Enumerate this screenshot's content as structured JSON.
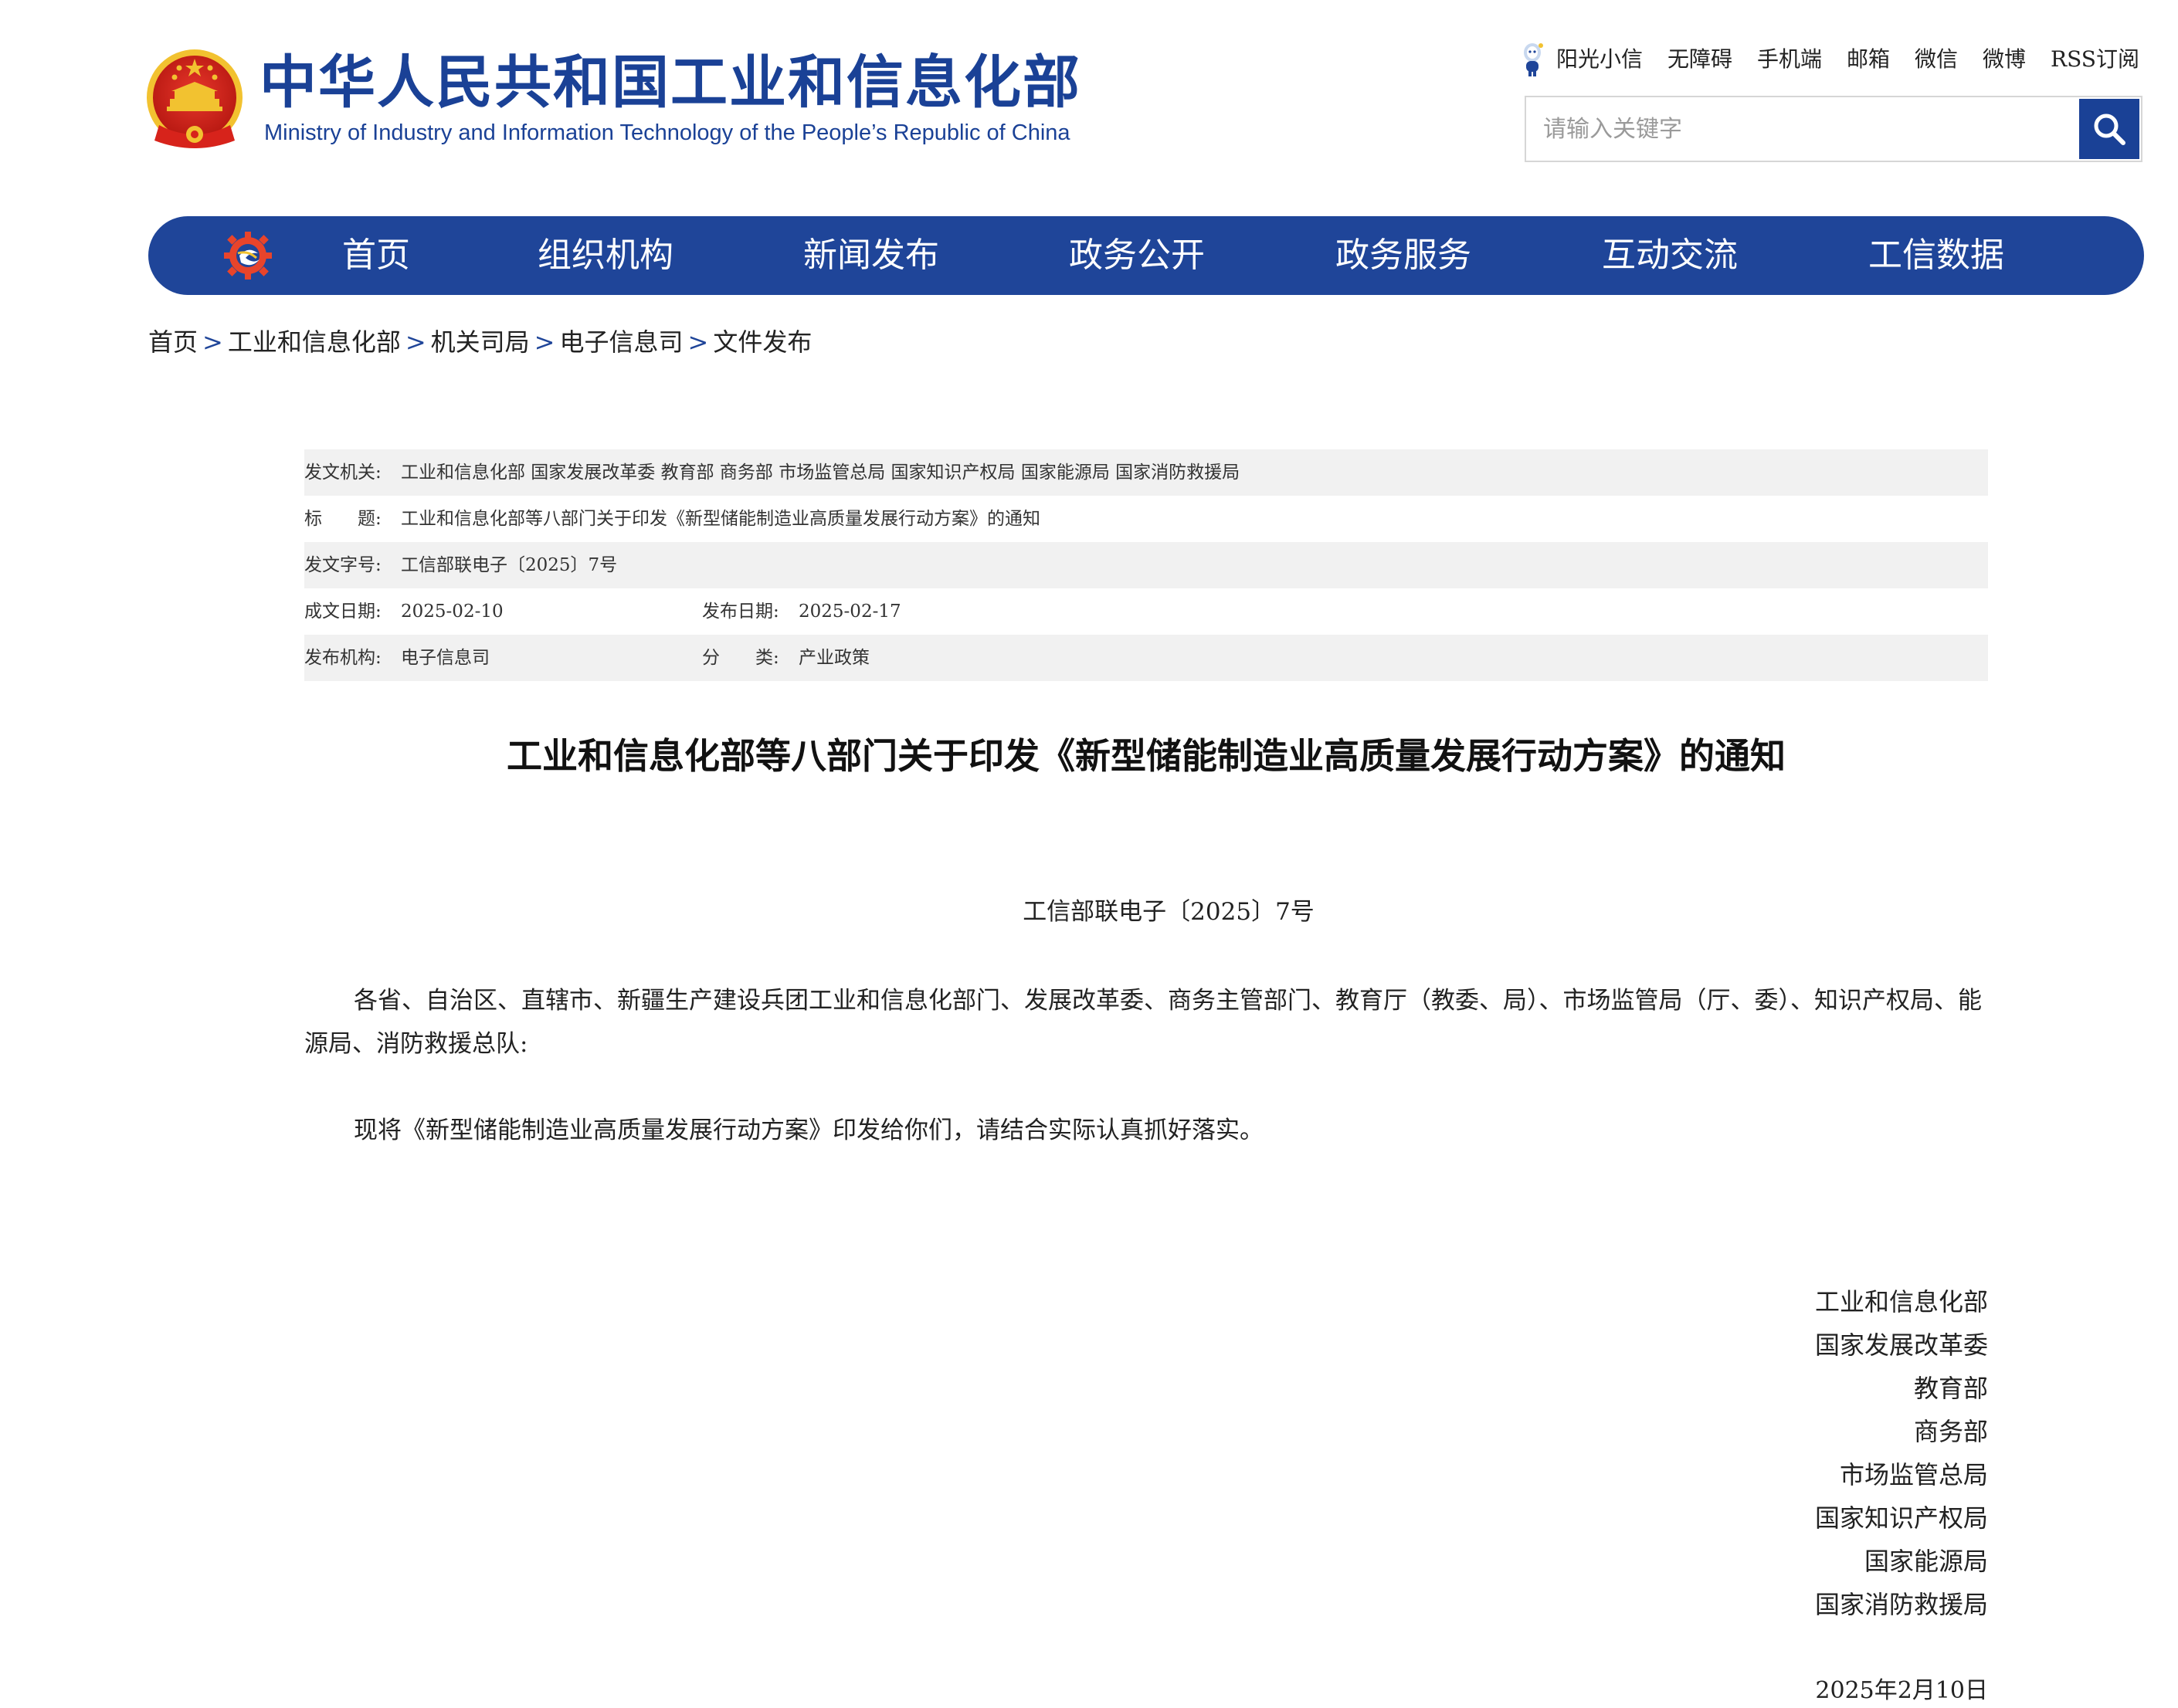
{
  "header": {
    "title_cn": "中华人民共和国工业和信息化部",
    "title_en": "Ministry of Industry and Information Technology of the People’s Republic of China",
    "top_links": [
      "阳光小信",
      "无障碍",
      "手机端",
      "邮箱",
      "微信",
      "微博",
      "RSS订阅"
    ],
    "search": {
      "placeholder": "请输入关键字",
      "value": ""
    }
  },
  "nav": {
    "items": [
      "首页",
      "组织机构",
      "新闻发布",
      "政务公开",
      "政务服务",
      "互动交流",
      "工信数据"
    ]
  },
  "breadcrumb": [
    "首页",
    "工业和信息化部",
    "机关司局",
    "电子信息司",
    "文件发布"
  ],
  "meta": {
    "issuer_label": "发文机关:",
    "issuer": "工业和信息化部 国家发展改革委 教育部 商务部 市场监管总局 国家知识产权局 国家能源局 国家消防救援局",
    "title_label": "标　　题:",
    "title": "工业和信息化部等八部门关于印发《新型储能制造业高质量发展行动方案》的通知",
    "docno_label": "发文字号:",
    "docno": "工信部联电子〔2025〕7号",
    "created_label": "成文日期:",
    "created": "2025-02-10",
    "published_label": "发布日期:",
    "published": "2025-02-17",
    "org_label": "发布机构:",
    "org": "电子信息司",
    "category_label": "分　　类:",
    "category": "产业政策"
  },
  "article": {
    "title": "工业和信息化部等八部门关于印发《新型储能制造业高质量发展行动方案》的通知",
    "doc_number": "工信部联电子〔2025〕7号",
    "para1": "各省、自治区、直辖市、新疆生产建设兵团工业和信息化部门、发展改革委、商务主管部门、教育厅（教委、局）、市场监管局（厅、委）、知识产权局、能源局、消防救援总队:",
    "para2": "现将《新型储能制造业高质量发展行动方案》印发给你们，请结合实际认真抓好落实。",
    "signers": [
      "工业和信息化部",
      "国家发展改革委",
      "教育部",
      "商务部",
      "市场监管总局",
      "国家知识产权局",
      "国家能源局",
      "国家消防救援局"
    ],
    "date": "2025年2月10日"
  },
  "colors": {
    "brand_blue": "#1f4599",
    "logo_blue": "#1a4196",
    "emblem_red": "#d7231b",
    "emblem_gold": "#f2c230",
    "meta_shade": "#f1f1f1"
  },
  "icons": {
    "emblem": "national-emblem-icon",
    "mascot": "mascot-icon",
    "search": "search-icon",
    "nav_logo": "ministry-gear-logo-icon"
  }
}
